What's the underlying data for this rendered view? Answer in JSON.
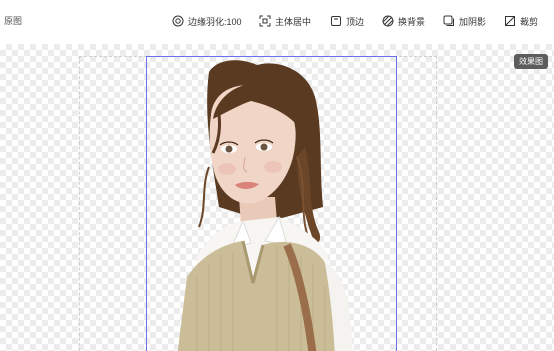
{
  "toolbar": {
    "original_label": "原图",
    "tools": [
      {
        "label": "边缘羽化:100",
        "icon": "feather-edge-icon"
      },
      {
        "label": "主体居中",
        "icon": "center-subject-icon"
      },
      {
        "label": "顶边",
        "icon": "top-edge-icon"
      },
      {
        "label": "换背景",
        "icon": "change-background-icon"
      },
      {
        "label": "加阴影",
        "icon": "add-shadow-icon"
      },
      {
        "label": "裁剪",
        "icon": "crop-icon"
      }
    ]
  },
  "canvas": {
    "effect_badge": "效果图"
  },
  "colors": {
    "selection_border": "#6b6ff0",
    "checker": "#ececec",
    "badge_bg": "#5d5d5d"
  }
}
